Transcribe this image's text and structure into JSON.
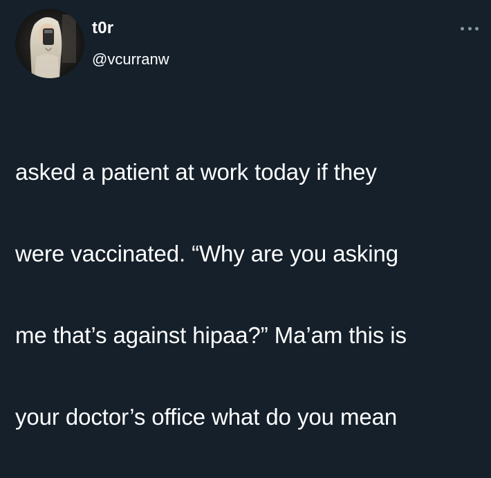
{
  "author": {
    "display_name": "t0r",
    "handle": "@vcurranw",
    "avatar_icon": "profile-photo"
  },
  "tweet": {
    "lines": [
      "asked a patient at work today if they",
      "were vaccinated. “Why are you asking",
      "me that’s against hipaa?” Ma’am this is",
      "your doctor’s office what do you mean"
    ]
  },
  "menu": {
    "icon": "more-options-icon"
  },
  "colors": {
    "background": "#15202b",
    "text": "#ffffff",
    "muted": "#8899a6"
  }
}
